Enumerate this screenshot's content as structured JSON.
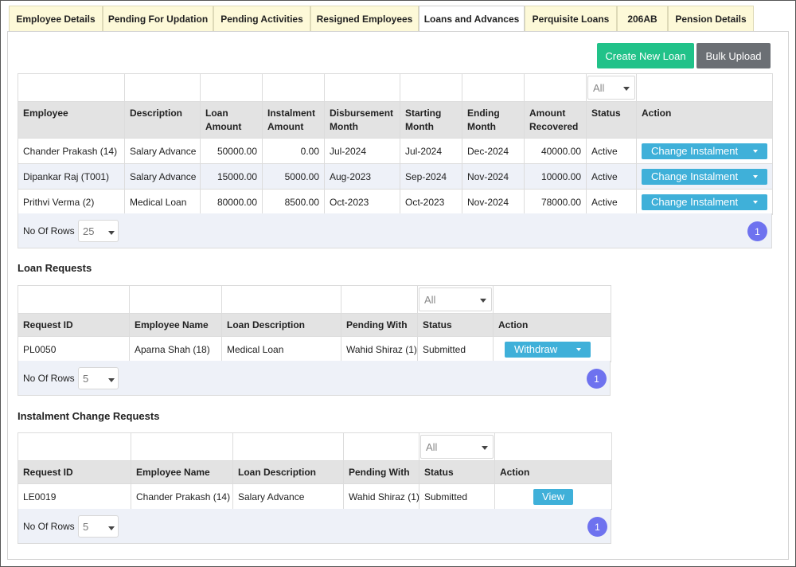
{
  "tabs": [
    {
      "label": "Employee Details"
    },
    {
      "label": "Pending For Updation"
    },
    {
      "label": "Pending Activities"
    },
    {
      "label": "Resigned Employees"
    },
    {
      "label": "Loans and Advances"
    },
    {
      "label": "Perquisite Loans"
    },
    {
      "label": "206AB"
    },
    {
      "label": "Pension Details"
    }
  ],
  "active_tab": "Loans and Advances",
  "toolbar": {
    "create_label": "Create New Loan",
    "bulk_label": "Bulk Upload"
  },
  "loans": {
    "status_filter": "All",
    "headers": [
      "Employee",
      "Description",
      "Loan Amount",
      "Instalment Amount",
      "Disbursement Month",
      "Starting Month",
      "Ending Month",
      "Amount Recovered",
      "Status",
      "Action"
    ],
    "rows": [
      {
        "employee": "Chander Prakash (14)",
        "description": "Salary Advance",
        "loan_amount": "50000.00",
        "instalment": "0.00",
        "disbursement": "Jul-2024",
        "starting": "Jul-2024",
        "ending": "Dec-2024",
        "recovered": "40000.00",
        "status": "Active",
        "action": "Change Instalment"
      },
      {
        "employee": "Dipankar Raj (T001)",
        "description": "Salary Advance",
        "loan_amount": "15000.00",
        "instalment": "5000.00",
        "disbursement": "Aug-2023",
        "starting": "Sep-2024",
        "ending": "Nov-2024",
        "recovered": "10000.00",
        "status": "Active",
        "action": "Change Instalment"
      },
      {
        "employee": "Prithvi Verma (2)",
        "description": "Medical Loan",
        "loan_amount": "80000.00",
        "instalment": "8500.00",
        "disbursement": "Oct-2023",
        "starting": "Oct-2023",
        "ending": "Nov-2024",
        "recovered": "78000.00",
        "status": "Active",
        "action": "Change Instalment"
      }
    ],
    "rows_label": "No Of Rows :",
    "rows_value": "25",
    "page": "1"
  },
  "loan_requests": {
    "title": "Loan Requests",
    "status_filter": "All",
    "headers": [
      "Request ID",
      "Employee Name",
      "Loan Description",
      "Pending With",
      "Status",
      "Action"
    ],
    "rows": [
      {
        "id": "PL0050",
        "name": "Aparna Shah (18)",
        "description": "Medical Loan",
        "pending_with": "Wahid Shiraz (1)",
        "status": "Submitted",
        "action": "Withdraw"
      }
    ],
    "rows_label": "No Of Rows :",
    "rows_value": "5",
    "page": "1"
  },
  "instalment_requests": {
    "title": "Instalment Change Requests",
    "status_filter": "All",
    "headers": [
      "Request ID",
      "Employee Name",
      "Loan Description",
      "Pending With",
      "Status",
      "Action"
    ],
    "rows": [
      {
        "id": "LE0019",
        "name": "Chander Prakash (14)",
        "description": "Salary Advance",
        "pending_with": "Wahid Shiraz (1)",
        "status": "Submitted",
        "action": "View"
      }
    ],
    "rows_label": "No Of Rows :",
    "rows_value": "5",
    "page": "1"
  },
  "colors": {
    "accent_green": "#21c289",
    "action_blue": "#3fb0d9",
    "page_purple": "#6e72ef",
    "tab_yellow": "#fdf9d8"
  },
  "icons": {
    "dropdown": "chevron-down-icon"
  }
}
